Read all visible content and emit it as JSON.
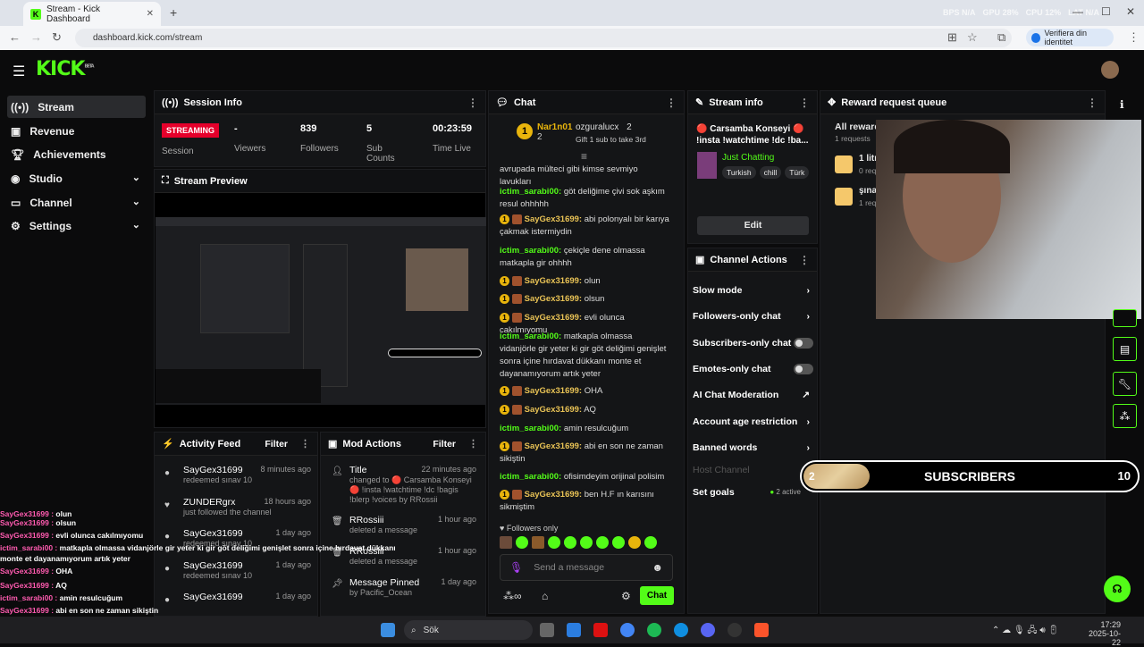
{
  "browser": {
    "tab_title": "Stream - Kick Dashboard",
    "url": "dashboard.kick.com/stream",
    "verify_label": "Verifiera din identitet",
    "stats": {
      "bps_label": "BPS",
      "bps_value": "N/A",
      "gpu_label": "GPU",
      "gpu_value": "28%",
      "cpu_label": "CPU",
      "cpu_value": "12%",
      "lat_label": "LAT",
      "lat_value": "N/A"
    }
  },
  "kick": {
    "logo": "KICK",
    "beta": "BETA"
  },
  "sidebar": {
    "items": [
      {
        "label": "Stream",
        "icon": "broadcast-icon"
      },
      {
        "label": "Revenue",
        "icon": "revenue-icon"
      },
      {
        "label": "Achievements",
        "icon": "trophy-icon"
      },
      {
        "label": "Studio",
        "icon": "studio-icon"
      },
      {
        "label": "Channel",
        "icon": "channel-icon"
      },
      {
        "label": "Settings",
        "icon": "gear-icon"
      }
    ]
  },
  "session": {
    "title": "Session Info",
    "status": "STREAMING",
    "status_label": "Session",
    "viewers_value": "-",
    "viewers_label": "Viewers",
    "followers_value": "839",
    "followers_label": "Followers",
    "subs_value": "5",
    "subs_label": "Sub Counts",
    "time_value": "00:23:59",
    "time_label": "Time Live"
  },
  "preview": {
    "title": "Stream Preview"
  },
  "activity": {
    "title": "Activity Feed",
    "filter": "Filter",
    "items": [
      {
        "name": "SayGex31699",
        "sub": "redeemed sınav 10",
        "time": "8 minutes ago"
      },
      {
        "name": "ZUNDERgrx",
        "sub": "just followed the channel",
        "time": "18 hours ago"
      },
      {
        "name": "SayGex31699",
        "sub": "redeemed sınav 10",
        "time": "1 day ago"
      },
      {
        "name": "SayGex31699",
        "sub": "redeemed sınav 10",
        "time": "1 day ago"
      },
      {
        "name": "SayGex31699",
        "sub": "",
        "time": "1 day ago"
      }
    ]
  },
  "mod": {
    "title": "Mod Actions",
    "filter": "Filter",
    "items": [
      {
        "name": "Title",
        "sub": "changed to 🔴 Carsamba Konseyi 🔴 !insta !watchtime !dc !bagis !blerp !voices by RRossii",
        "time": "22 minutes ago"
      },
      {
        "name": "RRossiii",
        "sub": "deleted a message",
        "time": "1 hour ago"
      },
      {
        "name": "RRossiii",
        "sub": "deleted a message",
        "time": "1 hour ago"
      },
      {
        "name": "Message Pinned",
        "sub": "by Pacific_Ocean",
        "time": "1 day ago"
      }
    ]
  },
  "chat": {
    "title": "Chat",
    "top1_name": "Nar1n01",
    "top1_count": "2",
    "top2_name": "ozguralucx",
    "top2_count": "2",
    "gift_text": "Gift 1 sub to take 3rd",
    "messages": [
      {
        "user": "",
        "text": "avrupada mülteci gibi kimse sevmiyo lavukları"
      },
      {
        "user": "ictim_sarabi00:",
        "text": "göt deliğime çivi sok aşkım resul ohhhhh"
      },
      {
        "user": "SayGex31699:",
        "text": "abi polonyalı bir karıya çakmak istermiydin"
      },
      {
        "user": "ictim_sarabi00:",
        "text": "çekiçle dene olmassa matkapla gir ohhhh"
      },
      {
        "user": "SayGex31699:",
        "text": "olun"
      },
      {
        "user": "SayGex31699:",
        "text": "olsun"
      },
      {
        "user": "SayGex31699:",
        "text": "evli olunca cakılmıyomu"
      },
      {
        "user": "ictim_sarabi00:",
        "text": "matkapla olmassa vidanjörle gir yeter ki gir göt deliğimi genişlet sonra içine hırdavat dükkanı monte et dayanamıyorum artık yeter"
      },
      {
        "user": "SayGex31699:",
        "text": "OHA"
      },
      {
        "user": "SayGex31699:",
        "text": "AQ"
      },
      {
        "user": "ictim_sarabi00:",
        "text": "amin resulcuğum"
      },
      {
        "user": "SayGex31699:",
        "text": "abi en son ne zaman sikiştin"
      },
      {
        "user": "ictim_sarabi00:",
        "text": "ofisimdeyim orijinal polisim"
      },
      {
        "user": "SayGex31699:",
        "text": "ben H.F ın karısını sikmiştim"
      }
    ],
    "followers_only": "Followers only",
    "placeholder": "Send a message",
    "send": "Chat"
  },
  "stream_info": {
    "title": "Stream info",
    "stream_title": "🔴 Carsamba Konseyi 🔴 !insta !watchtime !dc !ba...",
    "category": "Just Chatting",
    "tags": [
      "Turkish",
      "chill",
      "Türk"
    ],
    "edit": "Edit"
  },
  "channel_actions": {
    "title": "Channel Actions",
    "items": [
      {
        "label": "Slow mode",
        "kind": "chevron"
      },
      {
        "label": "Followers-only chat",
        "kind": "chevron"
      },
      {
        "label": "Subscribers-only chat",
        "kind": "toggle"
      },
      {
        "label": "Emotes-only chat",
        "kind": "toggle"
      },
      {
        "label": "AI Chat Moderation",
        "kind": "link"
      },
      {
        "label": "Account age restriction",
        "kind": "chevron"
      },
      {
        "label": "Banned words",
        "kind": "chevron"
      },
      {
        "label": "Host Channel",
        "kind": "disabled"
      },
      {
        "label": "Set goals",
        "kind": "chevron",
        "extra": "2 active"
      }
    ]
  },
  "reward": {
    "title": "Reward request queue",
    "all": "All reward",
    "requests": "1 requests",
    "items": [
      {
        "name": "1 litr",
        "sub": "0 req"
      },
      {
        "name": "şına",
        "sub": "1 req"
      }
    ]
  },
  "sub_goal": {
    "current": "2",
    "label": "SUBSCRIBERS",
    "target": "10",
    "fraction": 0.2
  },
  "overlay_chat": [
    {
      "user": "SayGex31699 :",
      "text": "olun"
    },
    {
      "user": "SayGex31699 :",
      "text": "olsun"
    },
    {
      "user": "SayGex31699 :",
      "text": "evli olunca cakılmıyomu"
    },
    {
      "user": "ictim_sarabi00 :",
      "text": "matkapla olmassa vidanjörle gir yeter ki gir göt deliğimi genişlet sonra içine hırdavat dükkanı"
    },
    {
      "user": "",
      "text": "monte et dayanamıyorum artık yeter"
    },
    {
      "user": "SayGex31699 :",
      "text": "OHA"
    },
    {
      "user": "SayGex31699 :",
      "text": "AQ"
    },
    {
      "user": "ictim_sarabi00 :",
      "text": "amin resulcuğum"
    },
    {
      "user": "SayGex31699 :",
      "text": "abi en son ne zaman sikiştin"
    },
    {
      "user": "ictim_sarabi00 :",
      "text": "ofisimdeyim orijinal polisim"
    },
    {
      "user": "31699 :",
      "text": "ben H.F ın karısını sikmiştim"
    }
  ],
  "taskbar": {
    "search": "Sök",
    "time": "17:29",
    "date": "2025-10-22"
  }
}
